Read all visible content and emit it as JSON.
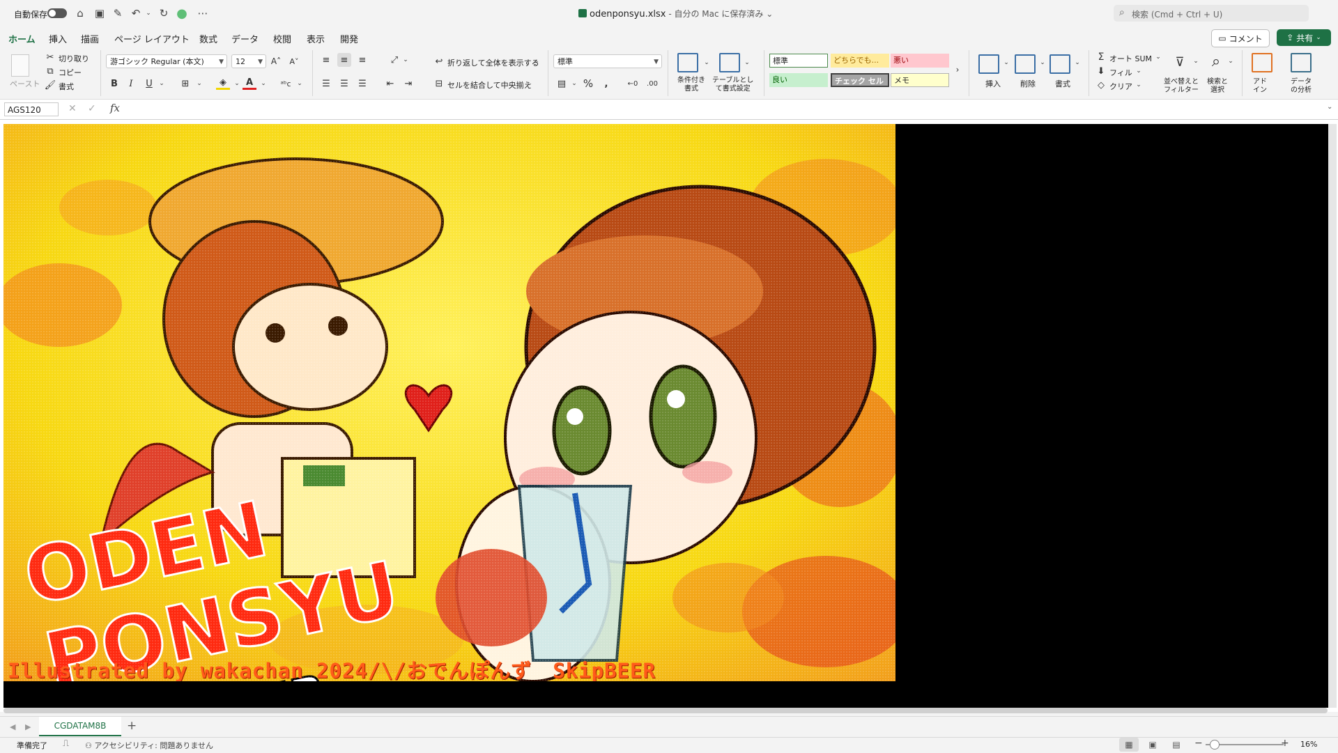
{
  "titlebar": {
    "autosave_label": "自動保存",
    "doc_name": "odenponsyu.xlsx",
    "doc_status": " - 自分の Mac に保存済み ⌄",
    "search_placeholder": "検索 (Cmd + Ctrl + U)"
  },
  "tabs": [
    "ホーム",
    "挿入",
    "描画",
    "ページ レイアウト",
    "数式",
    "データ",
    "校閲",
    "表示",
    "開発"
  ],
  "active_tab": "ホーム",
  "comment_label": "コメント",
  "share_label": "共有",
  "ribbon": {
    "paste": "ペースト",
    "cut": "切り取り",
    "copy": "コピー",
    "format_painter": "書式",
    "font_name": "游ゴシック Regular (本文)",
    "font_size": "12",
    "bold": "B",
    "italic": "I",
    "underline": "U",
    "wrap_text": "折り返して全体を表示する",
    "merge_center": "セルを結合して中央揃え",
    "number_format": "標準",
    "percent": "%",
    "cond_format_1": "条件付き",
    "cond_format_2": "書式",
    "table_format_1": "テーブルとし",
    "table_format_2": "て書式設定",
    "styles": {
      "normal": "標準",
      "neutral": "どちらでも...",
      "bad": "悪い",
      "good": "良い",
      "check_cell": "チェック セル",
      "note": "メモ"
    },
    "insert": "挿入",
    "delete": "削除",
    "format": "書式",
    "autosum": "オート SUM",
    "fill": "フィル",
    "clear": "クリア",
    "sort_filter_1": "並べ替えと",
    "sort_filter_2": "フィルター",
    "find_select_1": "検索と",
    "find_select_2": "選択",
    "addins_1": "アド",
    "addins_2": "イン",
    "analyze_1": "データ",
    "analyze_2": "の分析"
  },
  "formula_bar": {
    "name_box": "AGS120",
    "cancel": "✕",
    "enter": "✓",
    "fx": "fx",
    "value": ""
  },
  "artwork": {
    "credit": "Illustrated by wakachan 2024/\\/おでんぽんず　SkipBEER"
  },
  "sheet_tab": "CGDATAM8B",
  "add_sheet": "+",
  "status": {
    "ready": "準備完了",
    "accessibility": "アクセシビリティ: 問題ありません",
    "zoom": "16%",
    "zoom_fraction": 0.16
  },
  "colors": {
    "excel_green": "#1e7145",
    "art_yellow": "#f7dd12",
    "art_orange": "#f28a1c",
    "art_red": "#e0321a",
    "sheet_black": "#000000"
  }
}
